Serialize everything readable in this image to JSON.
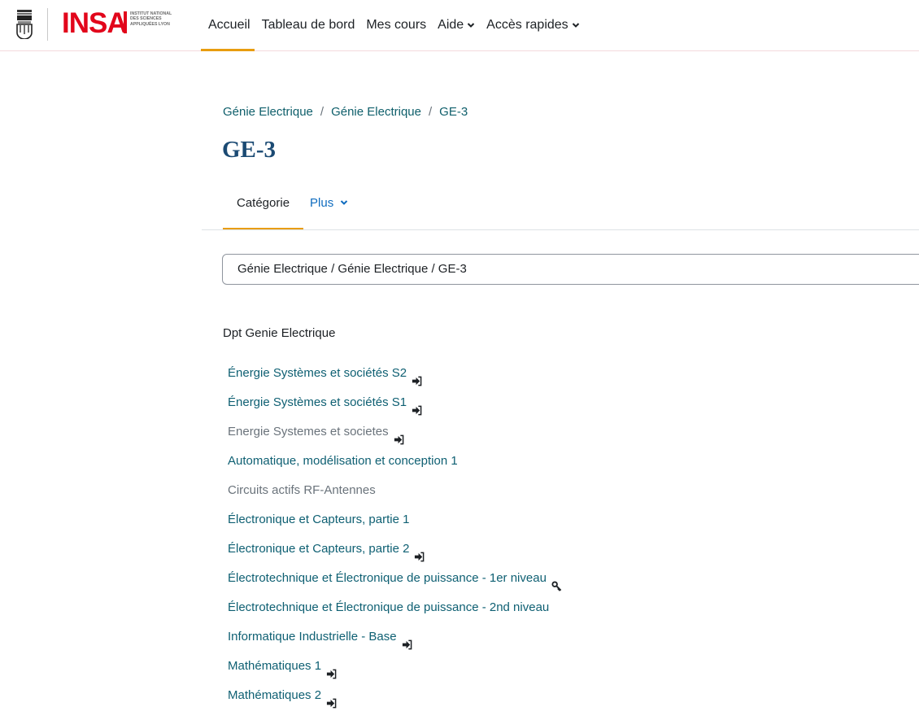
{
  "brand": {
    "logo_text": "INSA",
    "logo_subtext": "INSTITUT NATIONAL DES SCIENCES APPLIQUÉES LYON"
  },
  "nav": {
    "items": [
      {
        "label": "Accueil",
        "active": true,
        "dropdown": false
      },
      {
        "label": "Tableau de bord",
        "active": false,
        "dropdown": false
      },
      {
        "label": "Mes cours",
        "active": false,
        "dropdown": false
      },
      {
        "label": "Aide",
        "active": false,
        "dropdown": true
      },
      {
        "label": "Accès rapides",
        "active": false,
        "dropdown": true
      }
    ]
  },
  "breadcrumb": [
    {
      "label": "Génie Electrique"
    },
    {
      "label": "Génie Electrique"
    },
    {
      "label": "GE-3"
    }
  ],
  "breadcrumb_separator": "/",
  "page_title": "GE-3",
  "tabs": [
    {
      "label": "Catégorie",
      "active": true
    },
    {
      "label": "Plus",
      "active": false,
      "dropdown": true
    }
  ],
  "category_select": {
    "value": "Génie Electrique / Génie Electrique / GE-3"
  },
  "section": {
    "title": "Dpt Genie Electrique"
  },
  "courses": [
    {
      "name": "Énergie Systèmes et sociétés S2",
      "icon": "sign-in-icon",
      "dimmed": false
    },
    {
      "name": "Énergie Systèmes et sociétés S1",
      "icon": "sign-in-icon",
      "dimmed": false
    },
    {
      "name": "Energie Systemes et societes",
      "icon": "sign-in-icon",
      "dimmed": true
    },
    {
      "name": "Automatique, modélisation et conception 1",
      "icon": "",
      "dimmed": false
    },
    {
      "name": "Circuits actifs RF-Antennes",
      "icon": "",
      "dimmed": true
    },
    {
      "name": "Électronique et Capteurs, partie 1",
      "icon": "",
      "dimmed": false
    },
    {
      "name": "Électronique et Capteurs, partie 2",
      "icon": "sign-in-icon",
      "dimmed": false
    },
    {
      "name": "Électrotechnique et Électronique de puissance - 1er niveau",
      "icon": "key-icon",
      "dimmed": false
    },
    {
      "name": "Électrotechnique et Électronique de puissance - 2nd niveau",
      "icon": "",
      "dimmed": false
    },
    {
      "name": "Informatique Industrielle - Base",
      "icon": "sign-in-icon",
      "dimmed": false
    },
    {
      "name": "Mathématiques 1",
      "icon": "sign-in-icon",
      "dimmed": false
    },
    {
      "name": "Mathématiques 2",
      "icon": "sign-in-icon",
      "dimmed": false
    }
  ],
  "colors": {
    "accent": "#e89d0f",
    "brand_red": "#e2061b",
    "link": "#0f6073",
    "title": "#1b4a73",
    "dimmed": "#6a737b"
  }
}
